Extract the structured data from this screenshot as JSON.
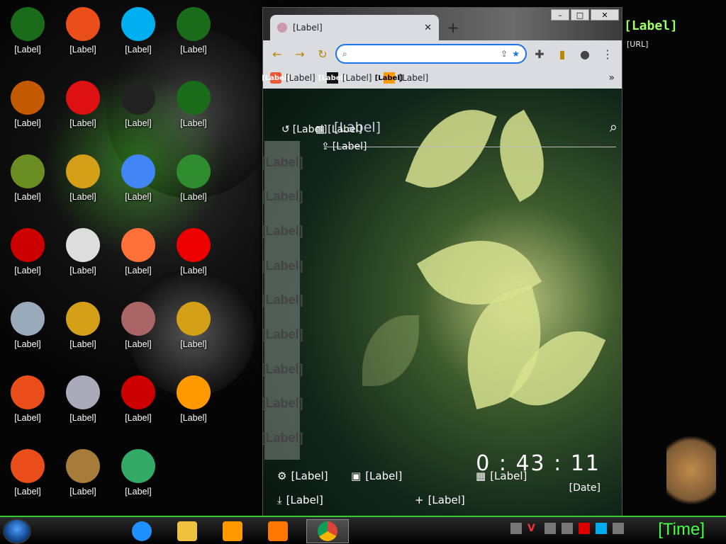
{
  "desktop_icons": [
    {
      "label": "[Label]",
      "color": "#1a6b1a"
    },
    {
      "label": "[Label]",
      "color": "#e94e1b"
    },
    {
      "label": "[Label]",
      "color": "#00aff0"
    },
    {
      "label": "[Label]",
      "color": "#1a6b1a"
    },
    {
      "label": "[Label]",
      "color": "#c45a00"
    },
    {
      "label": "[Label]",
      "color": "#d11"
    },
    {
      "label": "[Label]",
      "color": "#222"
    },
    {
      "label": "[Label]",
      "color": "#1a6b1a"
    },
    {
      "label": "[Label]",
      "color": "#6b8e23"
    },
    {
      "label": "[Label]",
      "color": "#d4a017"
    },
    {
      "label": "[Label]",
      "color": "#4285f4"
    },
    {
      "label": "[Label]",
      "color": "#2e8b2e"
    },
    {
      "label": "[Label]",
      "color": "#c00"
    },
    {
      "label": "[Label]",
      "color": "#ddd"
    },
    {
      "label": "[Label]",
      "color": "#ff7139"
    },
    {
      "label": "[Label]",
      "color": "#e00"
    },
    {
      "label": "[Label]",
      "color": "#9ab"
    },
    {
      "label": "[Label]",
      "color": "#d4a017"
    },
    {
      "label": "[Label]",
      "color": "#a66"
    },
    {
      "label": "[Label]",
      "color": "#d4a017"
    },
    {
      "label": "[Label]",
      "color": "#e94e1b"
    },
    {
      "label": "[Label]",
      "color": "#aab"
    },
    {
      "label": "[Label]",
      "color": "#c00"
    },
    {
      "label": "[Label]",
      "color": "#f90"
    },
    {
      "label": "[Label]",
      "color": "#e94e1b"
    },
    {
      "label": "[Label]",
      "color": "#a77b3a"
    },
    {
      "label": "[Label]",
      "color": "#3a6"
    }
  ],
  "browser": {
    "tab_title": "[Label]",
    "tab_close": "✕",
    "new_tab": "+",
    "omnibox_placeholder": "",
    "bookmarks": [
      {
        "icon": "[Label]",
        "label": "[Label]"
      },
      {
        "icon": "[Label]",
        "label": "[Label]"
      },
      {
        "icon": "[Label]",
        "label": "[Label]"
      }
    ],
    "bookmarks_more": "»",
    "win_minimize": "–",
    "win_maximize": "□",
    "win_close": "✕"
  },
  "newtab": {
    "most_visited": "[Label]",
    "apps": "[Label]",
    "share": "[Label]",
    "search_placeholder": "[Label]",
    "social": [
      "[Label]",
      "[Label]",
      "[Label]",
      "[Label]",
      "[Label]",
      "[Label]",
      "[Label]",
      "[Label]",
      "[Label]"
    ],
    "clock": "0 : 43 : 11",
    "date": "[Date]",
    "settings": "[Label]",
    "change_wallpaper": "[Label]",
    "more_themes": "[Label]",
    "download_wallpaper": "[Label]",
    "new_note": "[Label]"
  },
  "decor": {
    "brand_line": "[Label]",
    "brand_url": "[URL]"
  },
  "taskbar": {
    "clock": "[Time]",
    "tray": [
      "[Label]",
      "[Label]",
      "[Label]",
      "[Label]",
      "[Label]",
      "[Label]",
      "[Label]"
    ]
  }
}
